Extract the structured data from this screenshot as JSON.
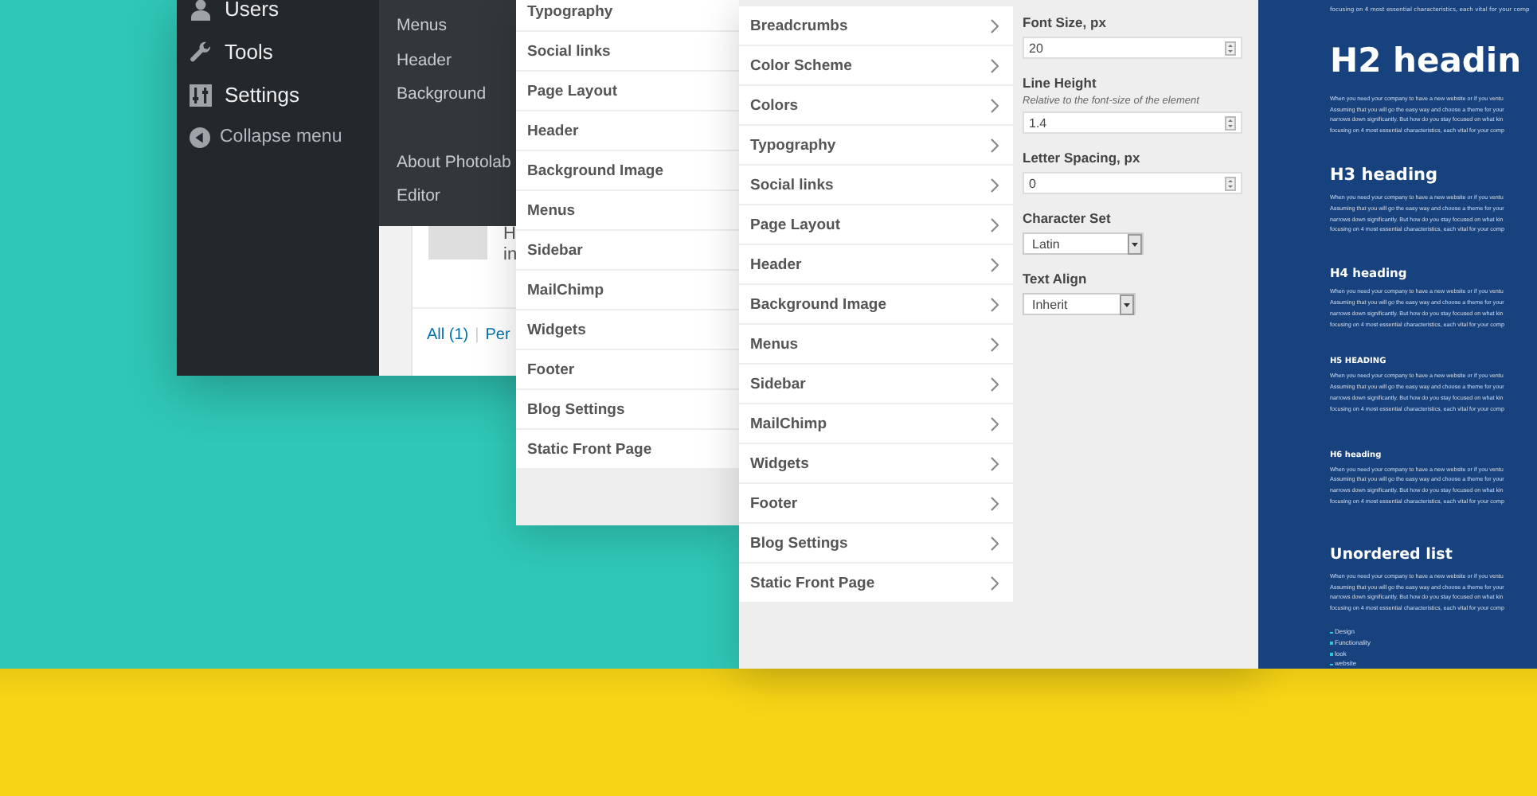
{
  "admin": {
    "menu": [
      {
        "kind": "link",
        "label": "Users"
      },
      {
        "kind": "link",
        "label": "Tools"
      },
      {
        "kind": "link",
        "label": "Settings"
      },
      {
        "kind": "collapse",
        "label": "Collapse menu"
      }
    ],
    "submenu_groups": [
      {
        "items": [
          "Menus",
          "Header",
          "Background"
        ]
      },
      {
        "items": [
          "About Photolab",
          "Editor"
        ]
      }
    ],
    "comment_lines": [
      "H",
      "in"
    ],
    "filters": [
      {
        "label": "All (1)"
      },
      {
        "label": "Per"
      }
    ],
    "filter_separator": "|"
  },
  "back_panel": {
    "sections": [
      "Typography",
      "Social links",
      "Page Layout",
      "Header",
      "Background Image",
      "Menus",
      "Sidebar",
      "MailChimp",
      "Widgets",
      "Footer",
      "Blog Settings",
      "Static Front Page"
    ]
  },
  "front_panel": {
    "sections": [
      "Breadcrumbs",
      "Color Scheme",
      "Colors",
      "Typography",
      "Social links",
      "Page Layout",
      "Header",
      "Background Image",
      "Menus",
      "Sidebar",
      "MailChimp",
      "Widgets",
      "Footer",
      "Blog Settings",
      "Static Front Page"
    ],
    "settings": [
      {
        "kind": "number",
        "label": "Font Size, px",
        "value": "20"
      },
      {
        "kind": "number",
        "label": "Line Height",
        "note": "Relative to the font-size of the element",
        "value": "1.4"
      },
      {
        "kind": "number",
        "label": "Letter Spacing, px",
        "value": "0"
      },
      {
        "kind": "select",
        "label": "Character Set",
        "value": "Latin"
      },
      {
        "kind": "select",
        "label": "Text Align",
        "value": "Inherit"
      }
    ]
  },
  "preview": {
    "intro": "focusing on 4 most essential characteristics, each vital for your comp",
    "blocks": [
      {
        "kind": "h2",
        "text": "H2 headin",
        "lines": [
          "When you need your company to have a new website or if you ventu",
          "Assuming that you will go the easy way and choose a theme for your",
          "narrows down significantly. But how do you stay focused on what kin",
          "focusing on 4 most essential characteristics, each vital for your comp"
        ]
      },
      {
        "kind": "h3",
        "text": "H3 heading",
        "lines": [
          "When you need your company to have a new website or if you ventu",
          "Assuming that you will go the easy way and choose a theme for your",
          "narrows down significantly. But how do you stay focused on what kin",
          "focusing on 4 most essential characteristics, each vital for your comp"
        ]
      },
      {
        "kind": "h4",
        "text": "H4 heading",
        "lines": [
          "When you need your company to have a new website or if you ventu",
          "Assuming that you will go the easy way and choose a theme for your",
          "narrows down significantly. But how do you stay focused on what kin",
          "focusing on 4 most essential characteristics, each vital for your comp"
        ]
      },
      {
        "kind": "h5",
        "text": "H5 HEADING",
        "lines": [
          "When you need your company to have a new website or if you ventu",
          "Assuming that you will go the easy way and choose a theme for your",
          "narrows down significantly. But how do you stay focused on what kin",
          "focusing on 4 most essential characteristics, each vital for your comp"
        ]
      },
      {
        "kind": "h6",
        "text": "H6 heading",
        "lines": [
          "When you need your company to have a new website or if you ventu",
          "Assuming that you will go the easy way and choose a theme for your",
          "narrows down significantly. But how do you stay focused on what kin",
          "focusing on 4 most essential characteristics, each vital for your comp"
        ]
      },
      {
        "kind": "list",
        "text": "Unordered list",
        "lines": [
          "When you need your company to have a new website or if you ventu",
          "Assuming that you will go the easy way and choose a theme for your",
          "narrows down significantly. But how do you stay focused on what kin",
          "focusing on 4 most essential characteristics, each vital for your comp"
        ],
        "items": [
          "Design",
          "Functionality",
          "look",
          "website"
        ]
      }
    ]
  }
}
